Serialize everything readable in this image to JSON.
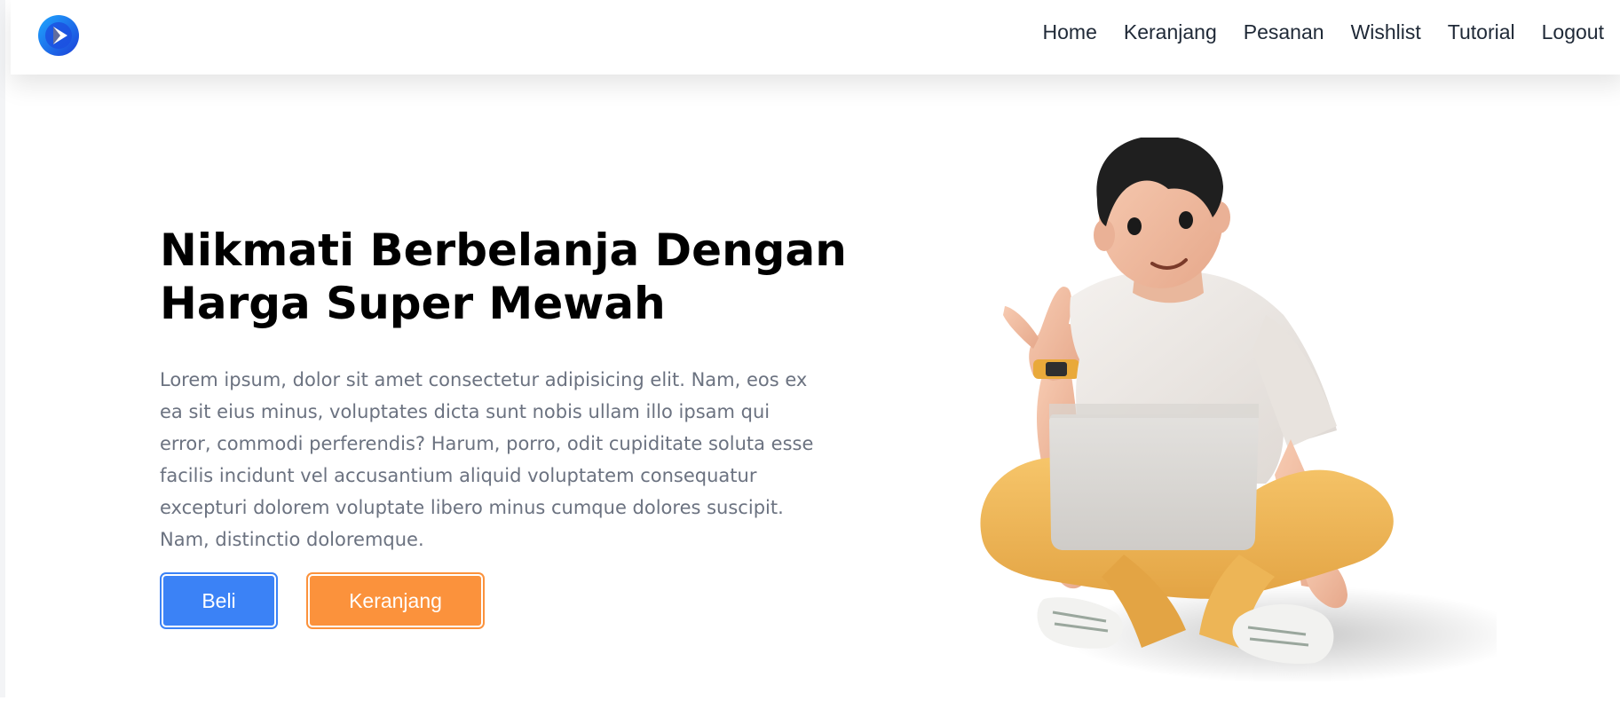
{
  "navbar": {
    "logo_icon": "play-logo-icon",
    "links": [
      "Home",
      "Keranjang",
      "Pesanan",
      "Wishlist",
      "Tutorial",
      "Logout"
    ]
  },
  "hero": {
    "title_lines": [
      "Nikmati Berbelanja Dengan",
      "Harga Super Mewah"
    ],
    "description_lines": [
      "Lorem ipsum, dolor sit amet consectetur adipisicing elit. Nam, eos ex",
      "ea sit eius minus, voluptates dicta sunt nobis ullam illo ipsam qui",
      "error, commodi perferendis? Harum, porro, odit cupiditate soluta esse",
      "facilis incidunt vel accusantium aliquid voluptatem consequatur",
      "excepturi dolorem voluptate libero minus cumque dolores suscipit.",
      "Nam, distinctio doloremque."
    ],
    "buy_label": "Beli",
    "cart_label": "Keranjang"
  },
  "colors": {
    "primary_blue": "#3b82f6",
    "accent_orange": "#fb923c",
    "text_muted": "#6b7280"
  },
  "illustration": {
    "subject": "3d-character-with-laptop"
  }
}
